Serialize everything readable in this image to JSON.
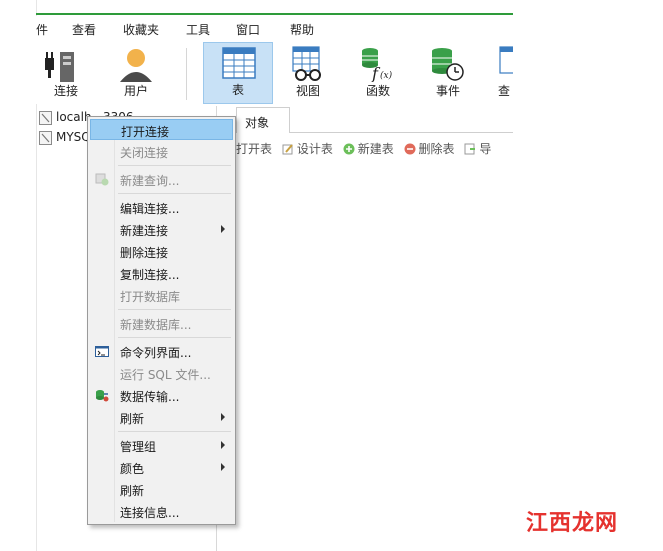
{
  "menubar": {
    "items": [
      "件",
      "查看",
      "收藏夹",
      "工具",
      "窗口",
      "帮助"
    ]
  },
  "toolbar": {
    "connect": "连接",
    "user": "用户",
    "table": "表",
    "view": "视图",
    "function": "函数",
    "event": "事件",
    "query": "查"
  },
  "tree": {
    "items": [
      "localh...3306",
      "MYSQ"
    ]
  },
  "object_tab": {
    "label": "对象"
  },
  "object_toolbar": {
    "open_table": "打开表",
    "design_table": "设计表",
    "new_table": "新建表",
    "delete_table": "删除表",
    "more": "导"
  },
  "context_menu": {
    "open_connection": "打开连接",
    "close_connection": "关闭连接",
    "new_query": "新建查询...",
    "edit_connection": "编辑连接...",
    "new_connection": "新建连接",
    "delete_connection": "删除连接",
    "copy_connection": "复制连接...",
    "open_database": "打开数据库",
    "new_database": "新建数据库...",
    "command_line": "命令列界面...",
    "run_sql_file": "运行 SQL 文件...",
    "data_transfer": "数据传输...",
    "refresh_sub": "刷新",
    "manage_group": "管理组",
    "color": "颜色",
    "refresh": "刷新",
    "connection_info": "连接信息..."
  },
  "watermark": "江西龙网",
  "colors": {
    "accent_green": "#2e9b3a",
    "highlight_blue": "#99cdf3",
    "active_tool_bg": "#c8e1f6",
    "watermark_red": "#e5322e"
  }
}
